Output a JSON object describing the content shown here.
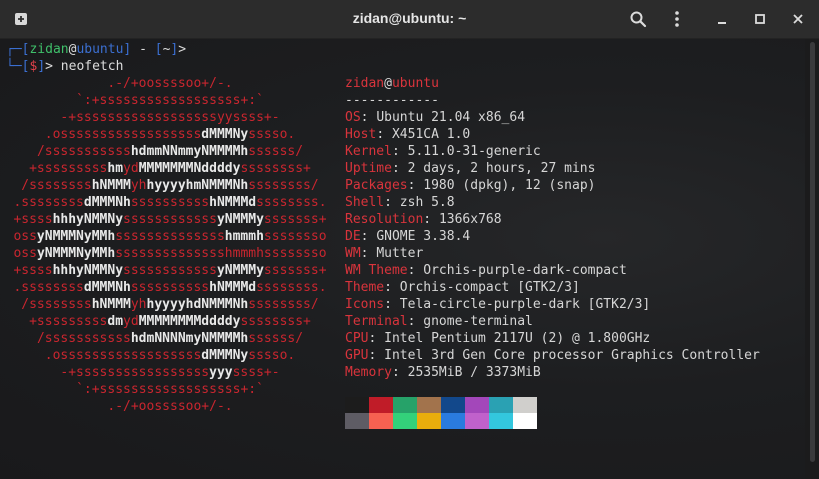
{
  "window": {
    "title": "zidan@ubuntu: ~"
  },
  "prompt": {
    "user": "zidan",
    "at": "@",
    "host": "ubuntu",
    "dir": "~",
    "symbol": "$",
    "command": "neofetch"
  },
  "ascii": [
    [
      [
        "r",
        ".-/+oossssoo+/-."
      ]
    ],
    [
      [
        "r",
        "`:+ssssssssssssssssss+:`"
      ]
    ],
    [
      [
        "r",
        "-+ssssssssssssssssssyyssss+-"
      ]
    ],
    [
      [
        "r",
        ".ossssssssssssssssss"
      ],
      [
        "w",
        "dMMMNy"
      ],
      [
        "r",
        "sssso."
      ]
    ],
    [
      [
        "r",
        "/sssssssssss"
      ],
      [
        "w",
        "hdmmNNmmyNMMMMh"
      ],
      [
        "r",
        "ssssss/"
      ]
    ],
    [
      [
        "r",
        "+sssssssss"
      ],
      [
        "w",
        "hm"
      ],
      [
        "r",
        "yd"
      ],
      [
        "w",
        "MMMMMMMNddddy"
      ],
      [
        "r",
        "ssssssss+"
      ]
    ],
    [
      [
        "r",
        "/ssssssss"
      ],
      [
        "w",
        "hNMMM"
      ],
      [
        "r",
        "yh"
      ],
      [
        "w",
        "hyyyyhmNMMMNh"
      ],
      [
        "r",
        "ssssssss/"
      ]
    ],
    [
      [
        "r",
        ".ssssssss"
      ],
      [
        "w",
        "dMMMNh"
      ],
      [
        "r",
        "ssssssssss"
      ],
      [
        "w",
        "hNMMMd"
      ],
      [
        "r",
        "ssssssss."
      ]
    ],
    [
      [
        "r",
        "+ssss"
      ],
      [
        "w",
        "hhhyNMMNy"
      ],
      [
        "r",
        "ssssssssssss"
      ],
      [
        "w",
        "yNMMMy"
      ],
      [
        "r",
        "sssssss+"
      ]
    ],
    [
      [
        "r",
        "oss"
      ],
      [
        "w",
        "yNMMMNyMMh"
      ],
      [
        "r",
        "ssssssssssssss"
      ],
      [
        "w",
        "hmmmh"
      ],
      [
        "r",
        "ssssssso"
      ]
    ],
    [
      [
        "r",
        "oss"
      ],
      [
        "w",
        "yNMMMNyMMh"
      ],
      [
        "r",
        "sssssssssssssshmmmhssssssso"
      ]
    ],
    [
      [
        "r",
        "+ssss"
      ],
      [
        "w",
        "hhhyNMMNy"
      ],
      [
        "r",
        "ssssssssssss"
      ],
      [
        "w",
        "yNMMMy"
      ],
      [
        "r",
        "sssssss+"
      ]
    ],
    [
      [
        "r",
        ".ssssssss"
      ],
      [
        "w",
        "dMMMNh"
      ],
      [
        "r",
        "ssssssssss"
      ],
      [
        "w",
        "hNMMMd"
      ],
      [
        "r",
        "ssssssss."
      ]
    ],
    [
      [
        "r",
        "/ssssssss"
      ],
      [
        "w",
        "hNMMM"
      ],
      [
        "r",
        "yh"
      ],
      [
        "w",
        "hyyyyhdNMMMNh"
      ],
      [
        "r",
        "ssssssss/"
      ]
    ],
    [
      [
        "r",
        "+sssssssss"
      ],
      [
        "w",
        "dm"
      ],
      [
        "r",
        "yd"
      ],
      [
        "w",
        "MMMMMMMMddddy"
      ],
      [
        "r",
        "ssssssss+"
      ]
    ],
    [
      [
        "r",
        "/sssssssssss"
      ],
      [
        "w",
        "hdmNNNNmyNMMMMh"
      ],
      [
        "r",
        "ssssss/"
      ]
    ],
    [
      [
        "r",
        ".ossssssssssssssssss"
      ],
      [
        "w",
        "dMMMNy"
      ],
      [
        "r",
        "sssso."
      ]
    ],
    [
      [
        "r",
        "-+sssssssssssssssss"
      ],
      [
        "w",
        "yyy"
      ],
      [
        "r",
        "ssss+-"
      ]
    ],
    [
      [
        "r",
        "`:+ssssssssssssssssss+:`"
      ]
    ],
    [
      [
        "r",
        ".-/+oossssoo+/-."
      ]
    ]
  ],
  "info": {
    "user": "zidan",
    "at": "@",
    "host": "ubuntu",
    "separator": "------------",
    "rows": [
      {
        "key": "OS",
        "value": "Ubuntu 21.04 x86_64"
      },
      {
        "key": "Host",
        "value": "X451CA 1.0"
      },
      {
        "key": "Kernel",
        "value": "5.11.0-31-generic"
      },
      {
        "key": "Uptime",
        "value": "2 days, 2 hours, 27 mins"
      },
      {
        "key": "Packages",
        "value": "1980 (dpkg), 12 (snap)"
      },
      {
        "key": "Shell",
        "value": "zsh 5.8"
      },
      {
        "key": "Resolution",
        "value": "1366x768"
      },
      {
        "key": "DE",
        "value": "GNOME 3.38.4"
      },
      {
        "key": "WM",
        "value": "Mutter"
      },
      {
        "key": "WM Theme",
        "value": "Orchis-purple-dark-compact"
      },
      {
        "key": "Theme",
        "value": "Orchis-compact [GTK2/3]"
      },
      {
        "key": "Icons",
        "value": "Tela-circle-purple-dark [GTK2/3]"
      },
      {
        "key": "Terminal",
        "value": "gnome-terminal"
      },
      {
        "key": "CPU",
        "value": "Intel Pentium 2117U (2) @ 1.800GHz"
      },
      {
        "key": "GPU",
        "value": "Intel 3rd Gen Core processor Graphics Controller"
      },
      {
        "key": "Memory",
        "value": "2535MiB / 3373MiB"
      }
    ]
  },
  "palette": [
    "#1c1c1c",
    "#c01c28",
    "#26a269",
    "#a2734c",
    "#12488b",
    "#a347ba",
    "#2aa1b3",
    "#d0cfcc",
    "#5e5c64",
    "#f66151",
    "#33d17a",
    "#e9ad0c",
    "#2a7bde",
    "#c061cb",
    "#33c7de",
    "#ffffff"
  ],
  "icons": {
    "new_tab": "new-tab-icon",
    "search": "search-icon",
    "menu": "kebab-menu-icon",
    "minimize": "minimize-icon",
    "maximize": "maximize-icon",
    "close": "close-icon"
  }
}
